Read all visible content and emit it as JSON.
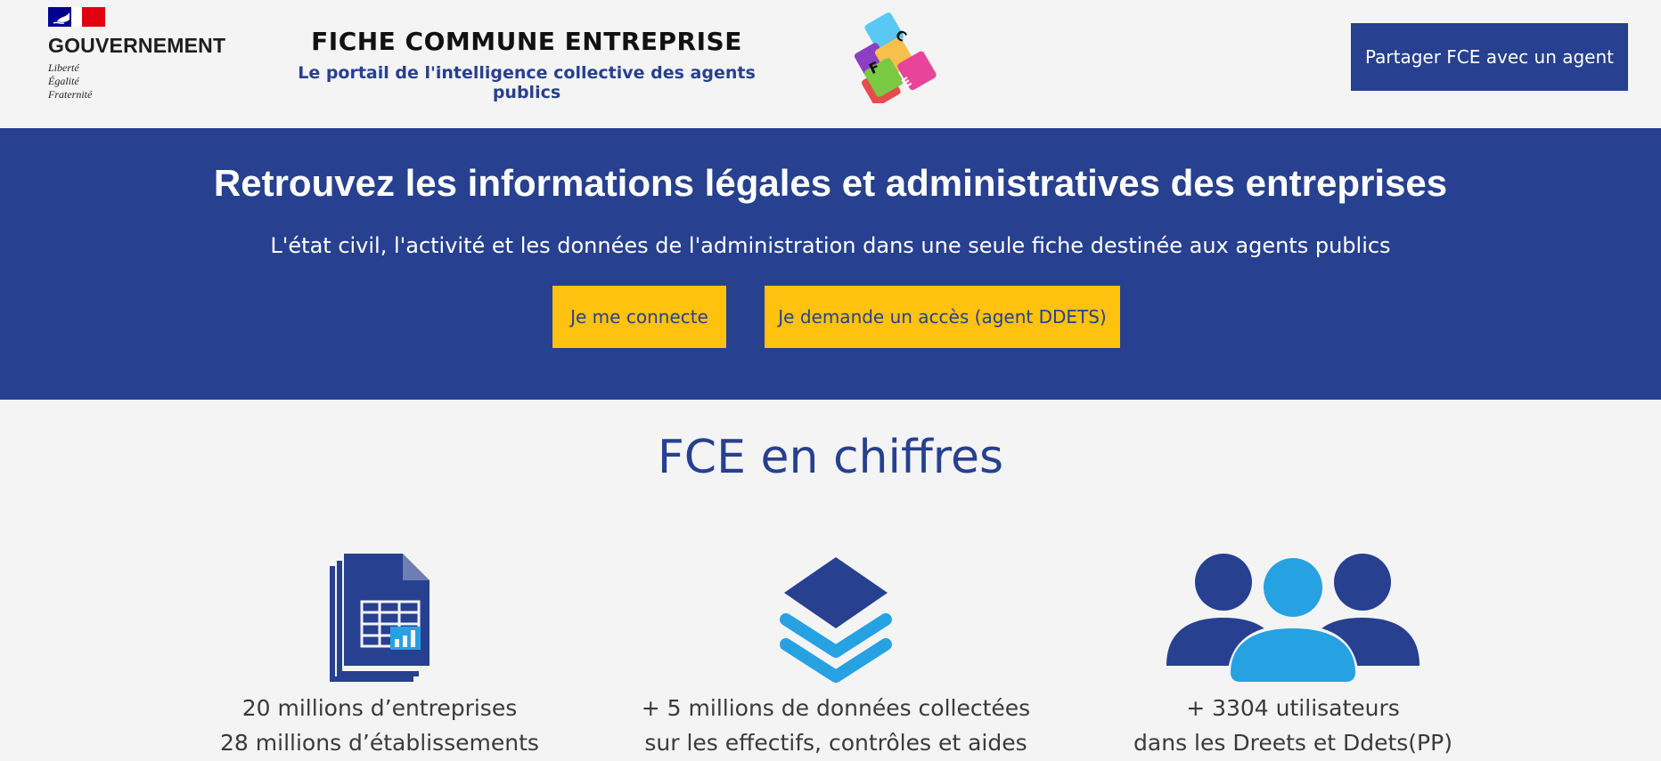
{
  "header": {
    "gov_word": "GOUVERNEMENT",
    "gov_motto": [
      "Liberté",
      "Égalité",
      "Fraternité"
    ],
    "title": "FICHE COMMUNE ENTREPRISE",
    "subtitle": "Le portail de l'intelligence collective des agents publics",
    "logo_letters": [
      "F",
      "C",
      "E"
    ],
    "share_button": "Partager FCE avec un agent"
  },
  "hero": {
    "title": "Retrouvez les informations légales et administratives des entreprises",
    "subtitle": "L'état civil, l'activité et les données de l'administration dans une seule fiche destinée aux agents publics",
    "login_button": "Je me connecte",
    "access_button": "Je demande un accès (agent DDETS)"
  },
  "stats": {
    "title": "FCE en chiffres",
    "items": [
      {
        "icon": "document-table-icon",
        "line1": "20 millions d’entreprises",
        "line2": "28 millions d’établissements"
      },
      {
        "icon": "layers-icon",
        "line1": "+ 5 millions de données collectées",
        "line2": "sur les effectifs, contrôles et aides"
      },
      {
        "icon": "users-icon",
        "line1": "+ 3304 utilisateurs",
        "line2": "dans les Dreets et Ddets(PP)"
      }
    ]
  },
  "colors": {
    "primary_blue": "#27408f",
    "accent_yellow": "#ffc20e",
    "light_blue": "#26a2e3",
    "background": "#f4f4f4"
  }
}
